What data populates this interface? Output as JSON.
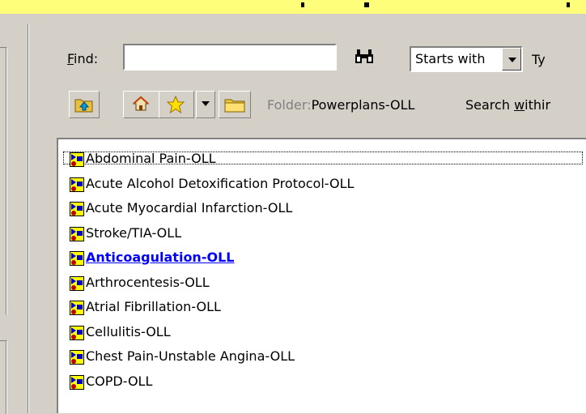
{
  "search": {
    "find_label_prefix": "",
    "find_label_underlined": "F",
    "find_label_rest": "ind:",
    "find_value": "",
    "match_mode": "Starts with",
    "type_label_partial": "Ty"
  },
  "toolbar": {
    "folder_label": "Folder:",
    "folder_value": "Powerplans-OLL",
    "search_within_prefix": "Search ",
    "search_within_underlined": "w",
    "search_within_rest": "ithir"
  },
  "list": {
    "items": [
      {
        "label": "Abdominal Pain-OLL",
        "selected": false
      },
      {
        "label": "Acute Alcohol Detoxification Protocol-OLL",
        "selected": false
      },
      {
        "label": "Acute Myocardial Infarction-OLL",
        "selected": false
      },
      {
        "label": "Stroke/TIA-OLL",
        "selected": false
      },
      {
        "label": "Anticoagulation-OLL",
        "selected": true
      },
      {
        "label": "Arthrocentesis-OLL",
        "selected": false
      },
      {
        "label": "Atrial Fibrillation-OLL",
        "selected": false
      },
      {
        "label": "Cellulitis-OLL",
        "selected": false
      },
      {
        "label": "Chest Pain-Unstable Angina-OLL",
        "selected": false
      },
      {
        "label": "COPD-OLL",
        "selected": false
      }
    ]
  },
  "colors": {
    "titlebar": "#fffe7a",
    "selected_text": "#0000ff",
    "icon_yellow": "#ffff00",
    "icon_blue": "#0000c0",
    "icon_red": "#c00000"
  }
}
